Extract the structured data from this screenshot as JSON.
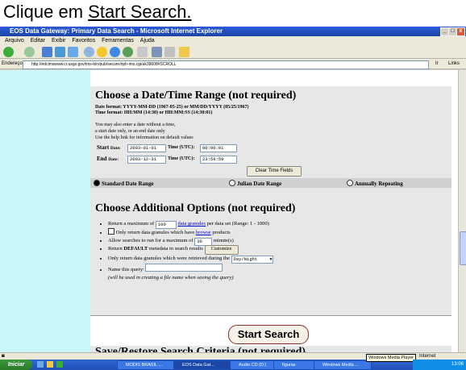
{
  "caption": {
    "prefix": "Clique em ",
    "link": "Start Search."
  },
  "window": {
    "title": "EOS Data Gateway: Primary Data Search - Microsoft Internet Explorer",
    "menu": [
      "Arquivo",
      "Editar",
      "Exibir",
      "Favoritos",
      "Ferramentas",
      "Ajuda"
    ],
    "address_label": "Endereço",
    "address": "http://edcimswww.cr.usgs.gov/ims-bin/pub/secure/nph-ims.cgi/ak39608#SCROLL",
    "go_label": "Ir",
    "links_label": "Links"
  },
  "date_section": {
    "title": "Choose a Date/Time Range (not required)",
    "format_date": "Date format: YYYY-MM-DD (1967-05-25) or MM/DD/YYYY (05/25/1967)",
    "format_time": "Time format: HH:MM (14:30) or HH:MM:SS (14:30:01)",
    "help1": "You may also enter a date without a time,",
    "help2": "a start date only, or an end date only",
    "help3": "Use the help link for information on default values",
    "start_label": "Start",
    "end_label": "End",
    "date_label": "Date:",
    "time_label": "Time (UTC):",
    "start_date": "2003-01-01",
    "start_time": "00:00:01",
    "end_date": "2003-12-31",
    "end_time": "23:59:59",
    "clear_button": "Clear Time Fields",
    "radio_standard": "Standard Date Range",
    "radio_julian": "Julian Date Range",
    "radio_annual": "Annually Repeating"
  },
  "options_section": {
    "title": "Choose Additional Options (not required)",
    "item1_a": "Return a maximum of",
    "item1_value": "100",
    "item1_link": "data granules",
    "item1_b": "per data set (Range: 1 - 1000)",
    "item2_a": "Only return data granules which have",
    "item2_link": "browse",
    "item2_b": "products",
    "item3_a": "Allow searches to run for a maximum of",
    "item3_value": "30",
    "item3_b": "minute(s)",
    "item4_a": "Return",
    "item4_bold": "DEFAULT",
    "item4_b": "metadata in search results",
    "customize_button": "Customize",
    "item5_a": "Only return data granules which were retrieved during the",
    "item5_select": "Day/Night",
    "item6_a": "Name this query:",
    "item6_note": "(will be used in creating a file name when saving the query)"
  },
  "start_search": "Start Search",
  "next_section_title": "Save/Restore Search Criteria (not required)",
  "statusbar": {
    "zone": "Internet"
  },
  "taskbar": {
    "start": "Iniciar",
    "tasks": [
      "MODIS BRASIL ...",
      "EOS Data Gat...",
      "Audio CD (D:)",
      "figuras",
      "Windows Media ..."
    ],
    "tooltip": "Windows Media Player",
    "clock": "13:06"
  }
}
